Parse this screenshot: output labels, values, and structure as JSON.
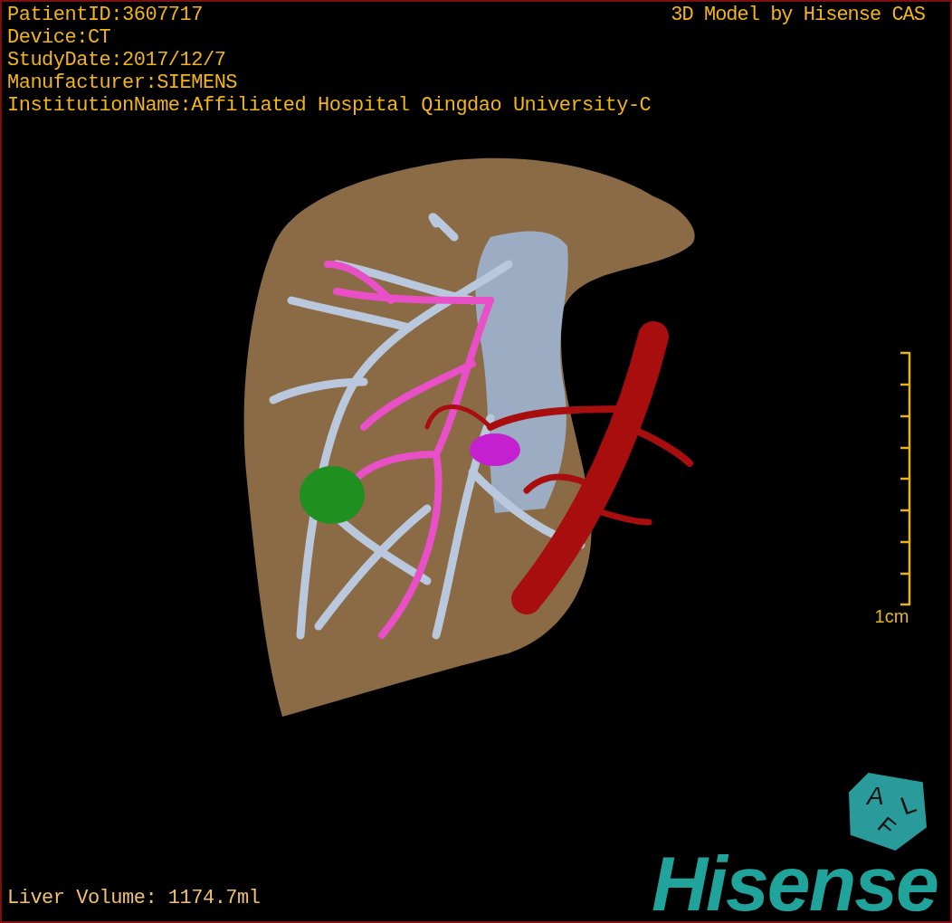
{
  "patient_info": [
    "PatientID:3607717",
    "Device:CT",
    "StudyDate:2017/12/7",
    "Manufacturer:SIEMENS",
    "InstitutionName:Affiliated Hospital Qingdao University-C"
  ],
  "model_credit": "3D Model by Hisense CAS",
  "scale_bar": {
    "label": "1cm"
  },
  "orientation_cube": {
    "faces": [
      "A",
      "L",
      "F"
    ]
  },
  "logo": "Hisense",
  "measurement": "Liver Volume: 1174.7ml"
}
